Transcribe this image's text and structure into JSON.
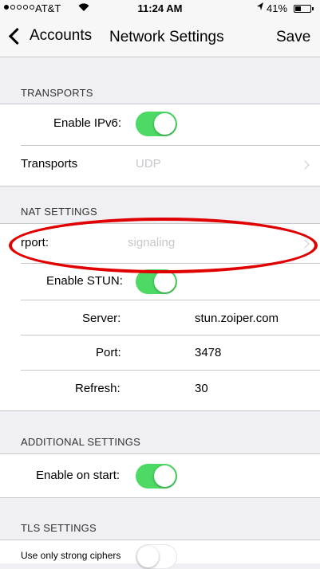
{
  "status_bar": {
    "carrier": "AT&T",
    "time": "11:24 AM",
    "battery_percent": "41%",
    "battery_level": 0.41
  },
  "nav": {
    "back_label": "Accounts",
    "title": "Network Settings",
    "save_label": "Save"
  },
  "transports": {
    "header": "TRANSPORTS",
    "enable_ipv6": {
      "label": "Enable IPv6:",
      "on": true
    },
    "transports": {
      "label": "Transports",
      "value": "UDP"
    }
  },
  "nat": {
    "header": "NAT SETTINGS",
    "rport": {
      "label": "rport:",
      "value": "signaling"
    },
    "enable_stun": {
      "label": "Enable STUN:",
      "on": true
    },
    "server": {
      "label": "Server:",
      "value": "stun.zoiper.com"
    },
    "port": {
      "label": "Port:",
      "value": "3478"
    },
    "refresh": {
      "label": "Refresh:",
      "value": "30"
    }
  },
  "additional": {
    "header": "ADDITIONAL SETTINGS",
    "enable_on_start": {
      "label": "Enable on start:",
      "on": true
    }
  },
  "tls": {
    "header": "TLS SETTINGS",
    "strong_ciphers": {
      "label": "Use only strong ciphers",
      "on": false
    }
  },
  "annotation": {
    "color": "#e00000"
  },
  "colors": {
    "toggle_on": "#4cd964",
    "background": "#efeff4"
  }
}
